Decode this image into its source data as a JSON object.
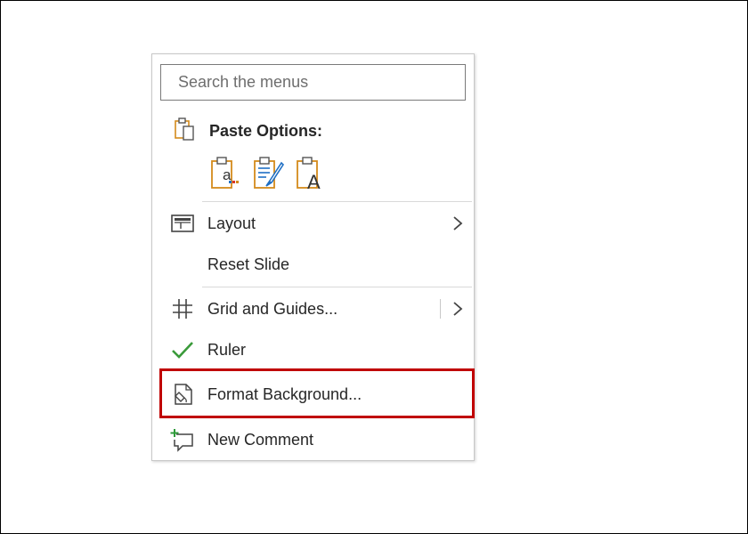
{
  "search": {
    "placeholder": "Search the menus"
  },
  "paste": {
    "title": "Paste Options:",
    "options": [
      {
        "icon": "paste-keep-text-only-icon",
        "glyph": "a"
      },
      {
        "icon": "paste-keep-source-formatting-icon",
        "glyph": ""
      },
      {
        "icon": "paste-picture-icon",
        "glyph": "A"
      }
    ]
  },
  "items": [
    {
      "label": "Layout",
      "icon": "layout-icon",
      "has_submenu": true
    },
    {
      "label": "Reset Slide",
      "icon": "",
      "has_submenu": false
    },
    {
      "label": "Grid and Guides...",
      "icon": "grid-icon",
      "has_submenu": true
    },
    {
      "label": "Ruler",
      "icon": "checkmark-icon",
      "checked": true
    },
    {
      "label": "Format Background...",
      "icon": "format-background-icon",
      "highlighted": true
    },
    {
      "label": "New Comment",
      "icon": "new-comment-icon"
    }
  ],
  "colors": {
    "highlight": "#c00000",
    "check": "#3a9a3a",
    "clipboard": "#d48a1c",
    "comment_plus": "#2e9a3a"
  }
}
